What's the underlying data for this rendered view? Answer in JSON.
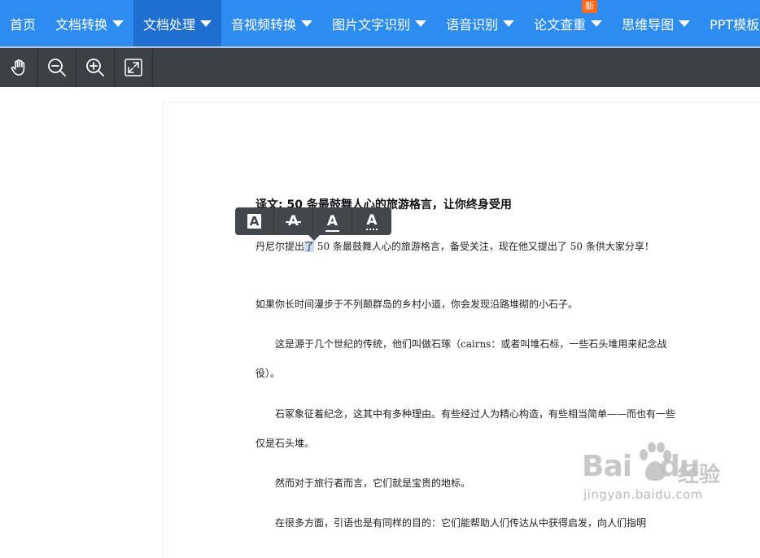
{
  "nav": {
    "items": [
      {
        "label": "首页",
        "dropdown": false,
        "active": false
      },
      {
        "label": "文档转换",
        "dropdown": true,
        "active": false
      },
      {
        "label": "文档处理",
        "dropdown": true,
        "active": true
      },
      {
        "label": "音视频转换",
        "dropdown": true,
        "active": false
      },
      {
        "label": "图片文字识别",
        "dropdown": true,
        "active": false
      },
      {
        "label": "语音识别",
        "dropdown": true,
        "active": false
      },
      {
        "label": "论文查重",
        "dropdown": true,
        "active": false,
        "badge": "新"
      },
      {
        "label": "思维导图",
        "dropdown": true,
        "active": false
      },
      {
        "label": "PPT模板",
        "dropdown": false,
        "active": false
      }
    ],
    "colors": {
      "bar": "#2d8cf0",
      "active": "#1f6fd0",
      "badge": "#ff6a1a"
    }
  },
  "toolbar": {
    "tools": [
      "hand-icon",
      "zoom-out-icon",
      "zoom-in-icon",
      "fit-screen-icon"
    ]
  },
  "float_toolbar": {
    "buttons": [
      "highlight-text-icon",
      "strikethrough-text-icon",
      "underline-text-icon",
      "squiggly-underline-text-icon"
    ],
    "glyph": "A"
  },
  "document": {
    "title": "译文: 50 条最鼓舞人心的旅游格言，让你终身受用",
    "p1_before": "丹尼尔提出",
    "p1_highlight": "了",
    "p1_after": " 50 条最鼓舞人心的旅游格言，备受关注，现在他又提出了 50 条供大家分享！",
    "p2": "如果你长时间漫步于不列颠群岛的乡村小道，你会发现沿路堆砌的小石子。",
    "p3": "　　这是源于几个世纪的传统，他们叫做石琢（cairns：或者叫堆石标，一些石头堆用来纪念战役）。",
    "p4": "　　石冢象征着纪念，这其中有多种理由。有些经过人为精心构造，有些相当简单——而也有一些仅是石头堆。",
    "p5": "　　然而对于旅行者而言，它们就是宝贵的地标。",
    "p6": "　　在很多方面，引语也是有同样的目的：它们能帮助人们传达从中获得启发，向人们指明"
  },
  "watermark": {
    "logo": "Bai",
    "logo2": "du",
    "cn": "经验",
    "url": "jingyan.baidu.com"
  }
}
